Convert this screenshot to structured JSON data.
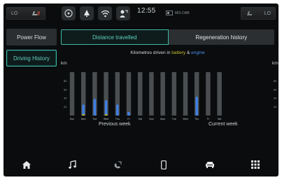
{
  "status_bar": {
    "climate_left": {
      "temp": "LO",
      "icon": "seat-heat-icon"
    },
    "climate_right": {
      "temp": "LO",
      "icon": "seat-heat-icon"
    },
    "buttons": [
      "disc-icon",
      "alert-icon",
      "wifi-icon",
      "profile-icon"
    ],
    "time": "12:55",
    "source": "MIS DAB"
  },
  "nav": {
    "power_flow": "Power Flow",
    "driving_history": "Driving History"
  },
  "tabs": {
    "distance": "Distance travelled",
    "regeneration": "Regeneration history"
  },
  "chart": {
    "title_prefix": "Kilometres driven in ",
    "title_battery": "battery",
    "title_amp": " & ",
    "title_engine": "engine",
    "unit_left": "km",
    "unit_right": "km",
    "previous_label": "Previous week",
    "current_label": "Current week"
  },
  "chart_data": {
    "type": "bar",
    "stacked": true,
    "categories": [
      "Sun",
      "Mon",
      "Tue",
      "Wed",
      "Thu",
      "Fr",
      "Sat",
      "Sun",
      "Mon",
      "Tue",
      "Wed",
      "Thu",
      "Fr",
      "Sat"
    ],
    "series": [
      {
        "name": "battery",
        "color": "#c9c02b",
        "values": [
          0,
          3,
          0,
          3,
          0,
          0,
          0,
          0,
          0,
          0,
          0,
          0,
          0,
          0
        ]
      },
      {
        "name": "engine",
        "color": "#3f7fe3",
        "values": [
          0,
          22,
          38,
          32,
          25,
          8,
          0,
          0,
          0,
          0,
          0,
          43,
          0,
          0
        ]
      }
    ],
    "y_ticks": [
      20,
      40,
      60,
      80
    ],
    "ylim": [
      0,
      100
    ],
    "track_color": "#4a4e51"
  },
  "dock": [
    "home-icon",
    "music-icon",
    "phone-icon",
    "mobile-icon",
    "car-icon",
    "apps-icon"
  ]
}
